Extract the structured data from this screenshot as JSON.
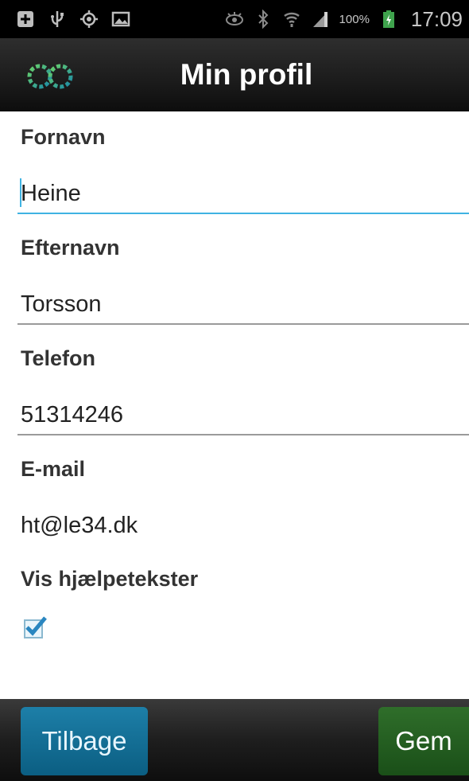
{
  "statusbar": {
    "icons": [
      "add-notification-icon",
      "usb-icon",
      "gps-icon",
      "gallery-icon",
      "eye-icon",
      "bluetooth-icon",
      "wifi-icon",
      "signal-icon",
      "battery-icon"
    ],
    "battery": "100%",
    "time": "17:09"
  },
  "actionbar": {
    "logo": "app-logo-icon",
    "title": "Min profil"
  },
  "form": {
    "first_name": {
      "label": "Fornavn",
      "value": "Heine"
    },
    "last_name": {
      "label": "Efternavn",
      "value": "Torsson"
    },
    "phone": {
      "label": "Telefon",
      "value": "51314246"
    },
    "email": {
      "label": "E-mail",
      "value": "ht@le34.dk"
    },
    "help_texts": {
      "label": "Vis hjælpetekster",
      "checked": true
    }
  },
  "buttons": {
    "back": "Tilbage",
    "save": "Gem"
  },
  "colors": {
    "accent": "#3fb3e2",
    "back_button": "#0b5e82",
    "save_button": "#1a4f18"
  }
}
